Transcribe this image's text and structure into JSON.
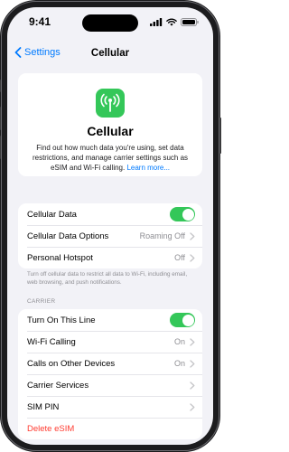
{
  "status_bar": {
    "time": "9:41"
  },
  "navbar": {
    "back_label": "Settings",
    "title": "Cellular"
  },
  "hero": {
    "icon": "antenna-icon",
    "title": "Cellular",
    "description": "Find out how much data you're using, set data restrictions, and manage carrier settings such as eSIM and Wi-Fi calling.",
    "link_text": "Learn more..."
  },
  "data_group": {
    "rows": [
      {
        "label": "Cellular Data",
        "toggle": true
      },
      {
        "label": "Cellular Data Options",
        "value": "Roaming Off"
      },
      {
        "label": "Personal Hotspot",
        "value": "Off"
      }
    ],
    "footnote": "Turn off cellular data to restrict all data to Wi-Fi, including email, web browsing, and push notifications."
  },
  "carrier_group": {
    "header": "CARRIER",
    "rows": [
      {
        "label": "Turn On This Line",
        "toggle": true
      },
      {
        "label": "Wi-Fi Calling",
        "value": "On"
      },
      {
        "label": "Calls on Other Devices",
        "value": "On"
      },
      {
        "label": "Carrier Services"
      },
      {
        "label": "SIM PIN"
      },
      {
        "label": "Delete eSIM"
      }
    ]
  },
  "colors": {
    "accent": "#007aff",
    "toggle_on": "#34c759",
    "destructive": "#ff3b30",
    "background": "#f2f2f7"
  }
}
